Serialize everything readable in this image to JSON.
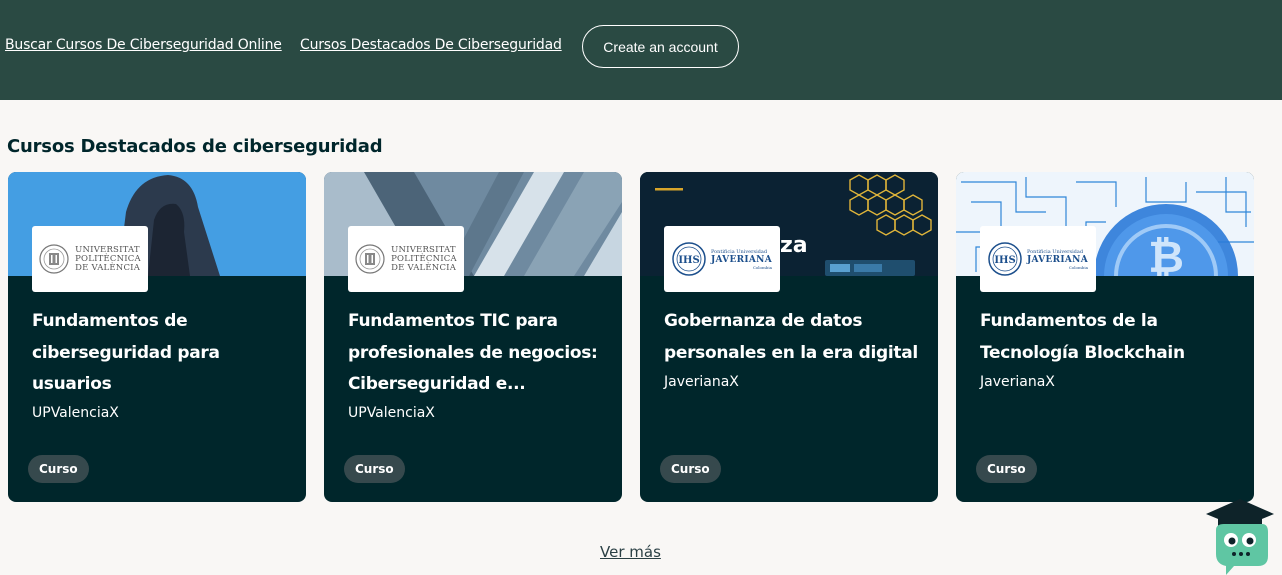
{
  "header": {
    "links": [
      {
        "label": "Buscar Cursos De Ciberseguridad Online"
      },
      {
        "label": "Cursos Destacados De Ciberseguridad"
      }
    ],
    "create_account_label": "Create an account"
  },
  "section": {
    "title": "Cursos Destacados de ciberseguridad"
  },
  "cards": [
    {
      "title": "Fundamentos de ciberseguridad para usuarios",
      "org": "UPValenciaX",
      "badge": "Curso",
      "logo": {
        "lines": [
          "UNIVERSITAT",
          "POLITÈCNICA",
          "DE VALÈNCIA"
        ]
      }
    },
    {
      "title": "Fundamentos TIC para profesionales de negocios: Ciberseguridad e...",
      "org": "UPValenciaX",
      "badge": "Curso",
      "logo": {
        "lines": [
          "UNIVERSITAT",
          "POLITÈCNICA",
          "DE VALÈNCIA"
        ]
      }
    },
    {
      "title": "Gobernanza de datos personales en la era digital",
      "org": "JaverianaX",
      "badge": "Curso",
      "hero_text": "za",
      "logo": {
        "lines": [
          "Pontificia Universidad",
          "JAVERIANA",
          "Colombia"
        ]
      }
    },
    {
      "title": "Fundamentos de la Tecnología Blockchain",
      "org": "JaverianaX",
      "badge": "Curso",
      "logo": {
        "lines": [
          "Pontificia Universidad",
          "JAVERIANA",
          "Colombia"
        ]
      }
    }
  ],
  "footer": {
    "ver_mas_label": "Ver más"
  },
  "colors": {
    "header_bg": "#2a4a43",
    "card_bg": "#00262b",
    "page_bg": "#f9f7f5",
    "badge_bg": "#36494d",
    "mascot": "#5fc6a3"
  },
  "icons": {
    "mascot": "graduation-cap-owl-icon",
    "seal": "university-seal-icon"
  }
}
